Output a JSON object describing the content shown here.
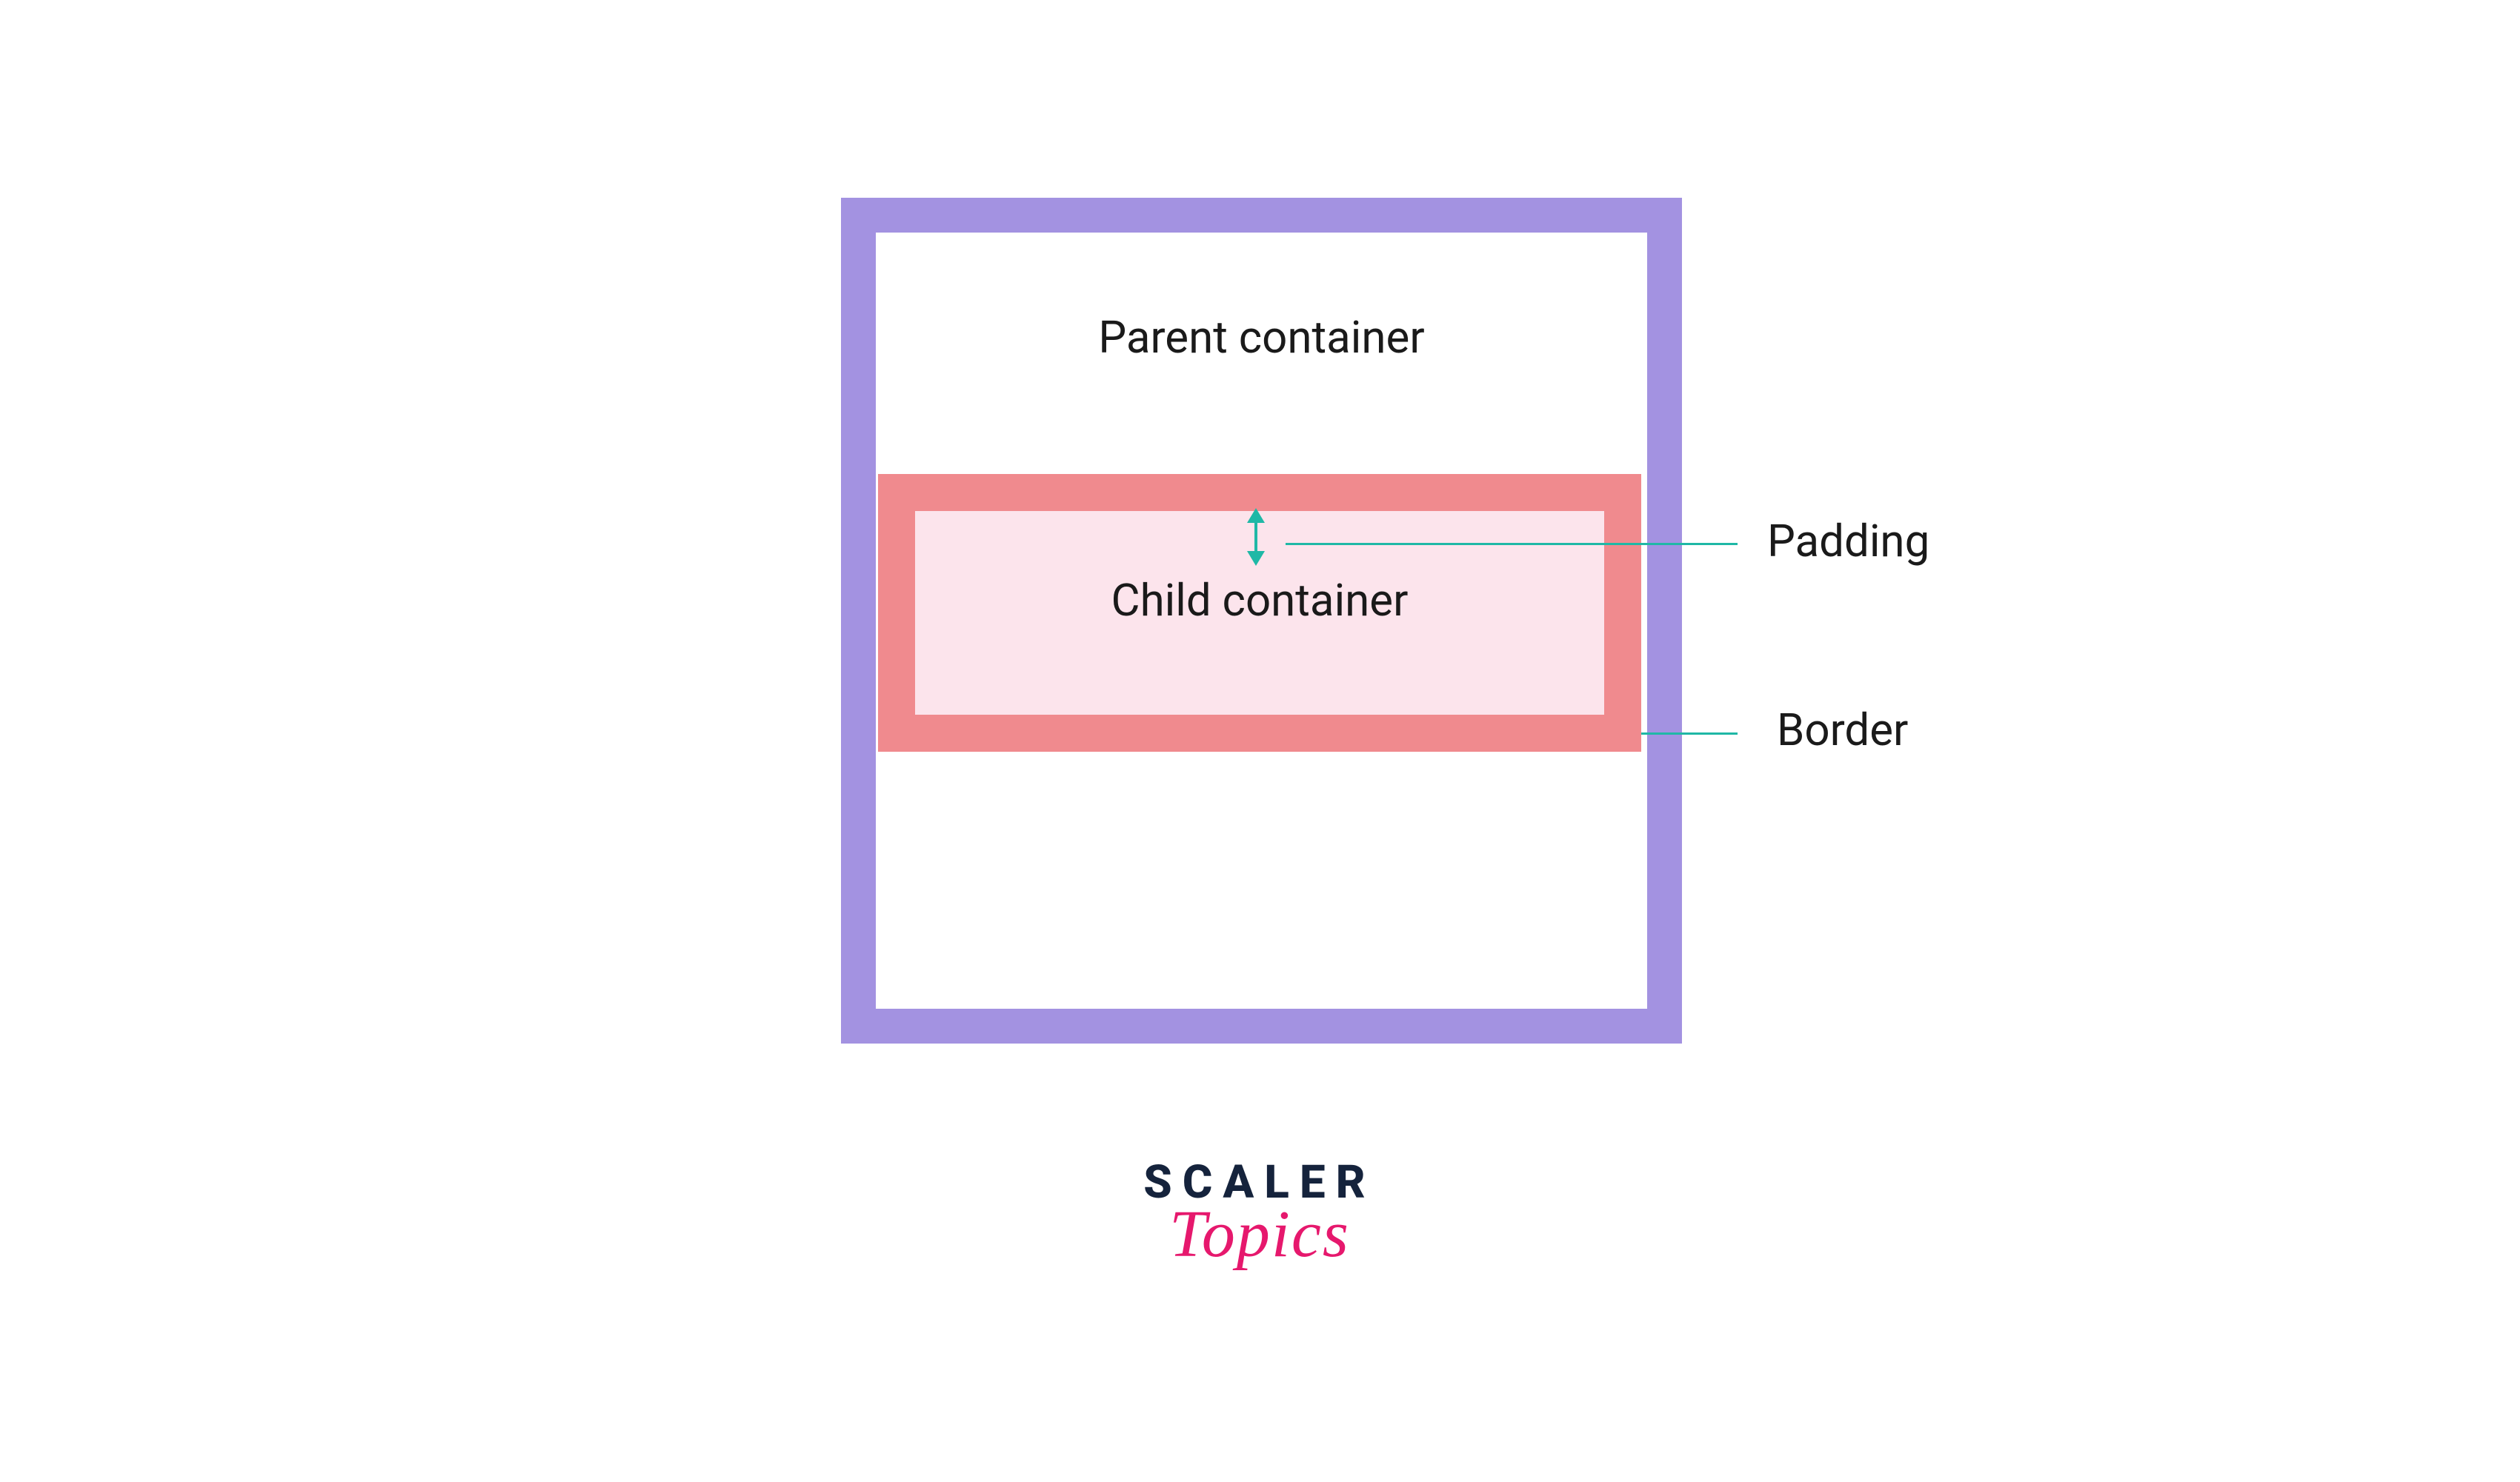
{
  "diagram": {
    "parent_label": "Parent container",
    "child_label": "Child container",
    "annotations": {
      "padding": "Padding",
      "border": "Border"
    }
  },
  "brand": {
    "line1": "SCALER",
    "line2": "Topics"
  },
  "colors": {
    "parent_border": "#a392e1",
    "child_border": "#f08a8e",
    "child_bg": "#fce4ec",
    "annotation_line": "#1fb8a6",
    "brand_primary": "#15233c",
    "brand_accent": "#e6186d"
  }
}
